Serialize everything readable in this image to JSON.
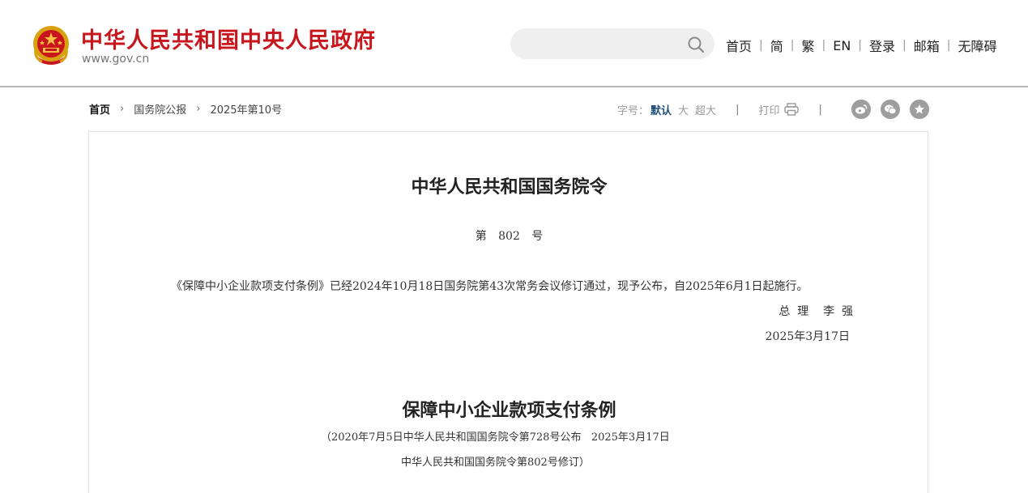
{
  "header": {
    "site_title": "中华人民共和国中央人民政府",
    "site_domain": "www.gov.cn",
    "search": {
      "value": "",
      "placeholder": ""
    },
    "nav": [
      "首页",
      "简",
      "繁",
      "EN",
      "登录",
      "邮箱",
      "无障碍"
    ],
    "brand_color": "#c8161d"
  },
  "breadcrumb": {
    "home": "首页",
    "level1": "国务院公报",
    "level2": "2025年第10号"
  },
  "toolbar": {
    "font_size_label": "字号：",
    "sizes": [
      "默认",
      "大",
      "超大"
    ],
    "active_size": "默认",
    "print_label": "打印",
    "share_icons": [
      "weibo-icon",
      "wechat-icon",
      "favorite-icon"
    ]
  },
  "document": {
    "order_title": "中华人民共和国国务院令",
    "order_number": "第 802 号",
    "order_body": "《保障中小企业款项支付条例》已经2024年10月18日国务院第43次常务会议修订通过，现予公布，自2025年6月1日起施行。",
    "signer": "总  理    李  强",
    "sign_date": "2025年3月17日",
    "regulation_title": "保障中小企业款项支付条例",
    "regulation_note_line1": "（2020年7月5日中华人民共和国国务院令第728号公布   2025年3月17日",
    "regulation_note_line2": "中华人民共和国国务院令第802号修订）"
  }
}
